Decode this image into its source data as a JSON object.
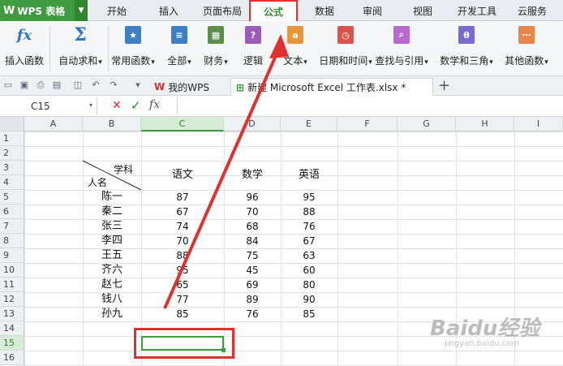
{
  "app": {
    "title": "WPS 表格",
    "logo_icon": "wps-logo-icon",
    "caret_icon": "chevron-down-icon"
  },
  "menu": {
    "tabs": [
      {
        "label": "开始"
      },
      {
        "label": "插入"
      },
      {
        "label": "页面布局"
      },
      {
        "label": "公式",
        "active": true
      },
      {
        "label": "数据"
      },
      {
        "label": "审阅"
      },
      {
        "label": "视图"
      },
      {
        "label": "开发工具"
      },
      {
        "label": "云服务"
      }
    ]
  },
  "ribbon": {
    "buttons": [
      {
        "label": "插入函数",
        "icon": "fx-icon",
        "color": "#2f74c0"
      },
      {
        "label": "自动求和",
        "icon": "sigma-icon",
        "color": "#2f74c0"
      },
      {
        "label": "常用函数",
        "icon": "star-function-icon",
        "color": "#3c7fc4"
      },
      {
        "label": "全部",
        "icon": "all-functions-icon",
        "color": "#3c7fc4"
      },
      {
        "label": "财务",
        "icon": "finance-icon",
        "color": "#5c8f4a"
      },
      {
        "label": "逻辑",
        "icon": "logic-icon",
        "color": "#9b5bb8"
      },
      {
        "label": "文本",
        "icon": "text-function-icon",
        "color": "#e8963a"
      },
      {
        "label": "日期和时间",
        "icon": "clock-icon",
        "color": "#d9534f"
      },
      {
        "label": "查找与引用",
        "icon": "lookup-icon",
        "color": "#b86ad1"
      },
      {
        "label": "数学和三角",
        "icon": "math-icon",
        "color": "#7a6ad1"
      },
      {
        "label": "其他函数",
        "icon": "more-functions-icon",
        "color": "#e8864a"
      }
    ],
    "dropdown_arrow": "▾"
  },
  "doc_tabs": {
    "home": "我的WPS",
    "file": "新建 Microsoft Excel 工作表.xlsx *",
    "add": "+"
  },
  "formula_bar": {
    "name_box": "C15",
    "cancel": "✕",
    "confirm": "✓",
    "fx": "fx"
  },
  "sheet": {
    "columns": [
      "A",
      "B",
      "C",
      "D",
      "E",
      "F",
      "G",
      "H",
      "I"
    ],
    "rows": [
      "1",
      "2",
      "3",
      "4",
      "5",
      "6",
      "7",
      "8",
      "9",
      "10",
      "11",
      "12",
      "13",
      "14",
      "15",
      "16"
    ],
    "header_top": "学科",
    "header_bottom": "人名",
    "subjects": [
      "语文",
      "数学",
      "英语"
    ],
    "students": [
      {
        "name": "陈一",
        "scores": [
          "87",
          "96",
          "95"
        ]
      },
      {
        "name": "秦二",
        "scores": [
          "67",
          "70",
          "88"
        ]
      },
      {
        "name": "张三",
        "scores": [
          "74",
          "68",
          "76"
        ]
      },
      {
        "name": "李四",
        "scores": [
          "70",
          "84",
          "67"
        ]
      },
      {
        "name": "王五",
        "scores": [
          "88",
          "75",
          "63"
        ]
      },
      {
        "name": "齐六",
        "scores": [
          "95",
          "45",
          "60"
        ]
      },
      {
        "name": "赵七",
        "scores": [
          "65",
          "69",
          "80"
        ]
      },
      {
        "name": "钱八",
        "scores": [
          "77",
          "89",
          "90"
        ]
      },
      {
        "name": "孙九",
        "scores": [
          "85",
          "76",
          "85"
        ]
      }
    ],
    "selected_cell": "C15"
  },
  "watermark": {
    "text": "Baidu经验",
    "sub": "jingyan.baidu.com"
  },
  "colors": {
    "accent": "#3f9b3f",
    "annotation": "#e03030"
  }
}
